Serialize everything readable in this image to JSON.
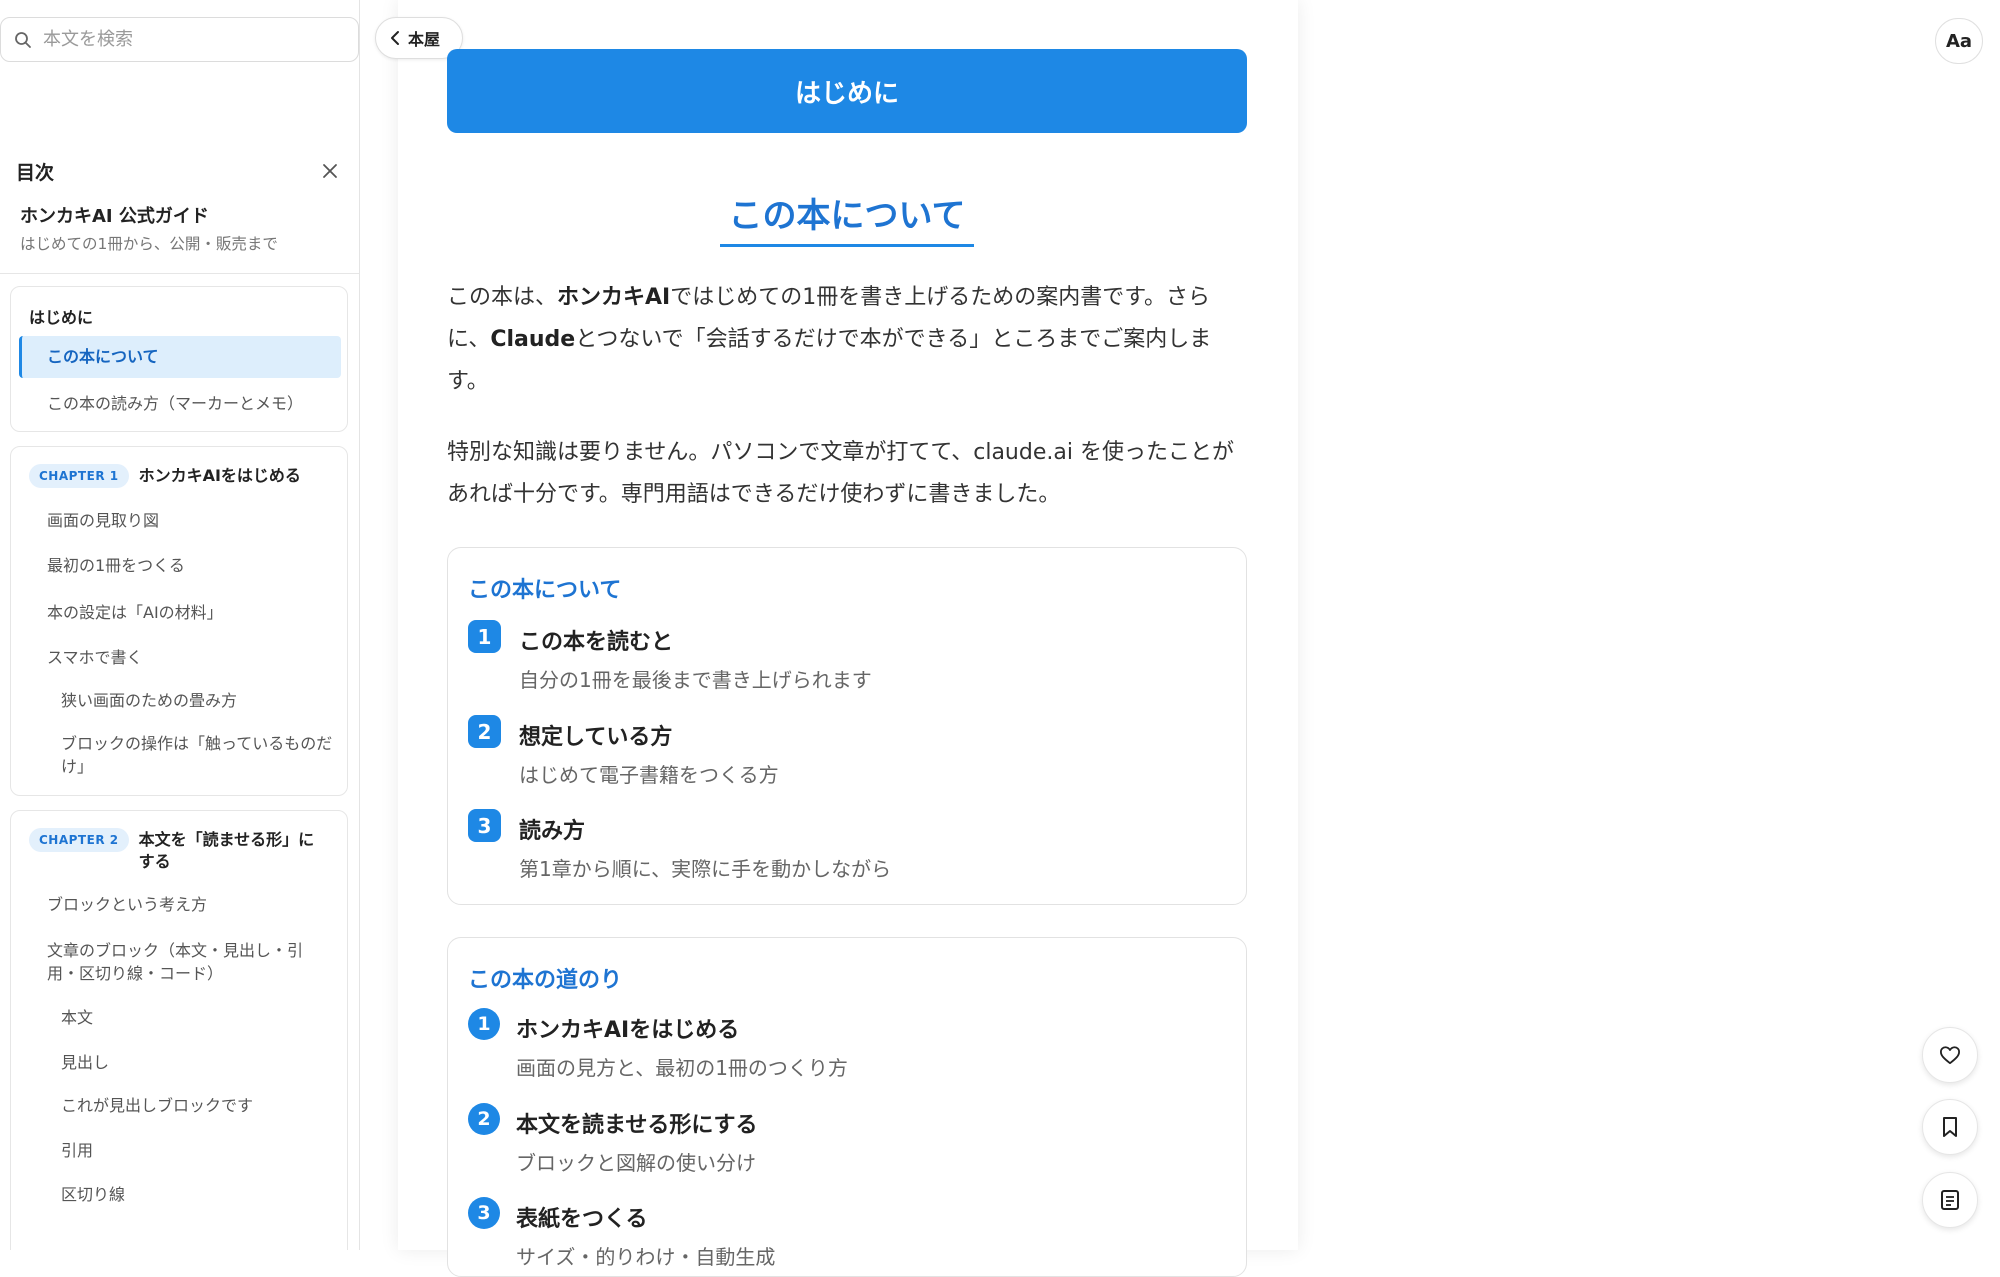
{
  "search": {
    "placeholder": "本文を検索"
  },
  "toc": {
    "title": "目次",
    "book_title": "ホンカキAI 公式ガイド",
    "book_subtitle": "はじめての1冊から、公開・販売まで",
    "intro": {
      "heading": "はじめに",
      "items": [
        "この本について",
        "この本の読み方（マーカーとメモ）"
      ]
    },
    "chapter1": {
      "badge": "CHAPTER 1",
      "title": "ホンカキAIをはじめる",
      "items": [
        "画面の見取り図",
        "最初の1冊をつくる",
        "本の設定は「AIの材料」",
        "スマホで書く"
      ],
      "subitems": [
        "狭い画面のための畳み方",
        "ブロックの操作は「触っているものだけ」"
      ]
    },
    "chapter2": {
      "badge": "CHAPTER 2",
      "title": "本文を「読ませる形」にする",
      "items": [
        "ブロックという考え方",
        "文章のブロック（本文・見出し・引用・区切り線・コード）"
      ],
      "subitems": [
        "本文",
        "見出し",
        "これが見出しブロックです",
        "引用",
        "区切り線"
      ]
    }
  },
  "main": {
    "back_label": "本屋",
    "chapter_banner": "はじめに",
    "section_title": "この本について",
    "para1": {
      "t1": "この本は、",
      "b1": "ホンカキAI",
      "t2": "ではじめての1冊を書き上げるための案内書です。さらに、",
      "b2": "Claude",
      "t3": "とつないで「会話するだけで本ができる」ところまでご案内します。"
    },
    "para2": "特別な知識は要りません。パソコンで文章が打てて、claude.ai を使ったことがあれば十分です。専門用語はできるだけ使わずに書きました。",
    "about_card": {
      "title": "この本について",
      "items": [
        {
          "num": "1",
          "title": "この本を読むと",
          "desc": "自分の1冊を最後まで書き上げられます"
        },
        {
          "num": "2",
          "title": "想定している方",
          "desc": "はじめて電子書籍をつくる方"
        },
        {
          "num": "3",
          "title": "読み方",
          "desc": "第1章から順に、実際に手を動かしながら"
        }
      ]
    },
    "road_card": {
      "title": "この本の道のり",
      "items": [
        {
          "num": "1",
          "title": "ホンカキAIをはじめる",
          "desc": "画面の見方と、最初の1冊のつくり方"
        },
        {
          "num": "2",
          "title": "本文を読ませる形にする",
          "desc": "ブロックと図解の使い分け"
        },
        {
          "num": "3",
          "title": "表紙をつくる",
          "desc": "サイズ・的りわけ・自動生成"
        }
      ]
    }
  },
  "controls": {
    "font_label": "Aa"
  },
  "colors": {
    "accent": "#1e88e5",
    "accent_text": "#1e74d2",
    "active_bg": "#ddeefc"
  }
}
